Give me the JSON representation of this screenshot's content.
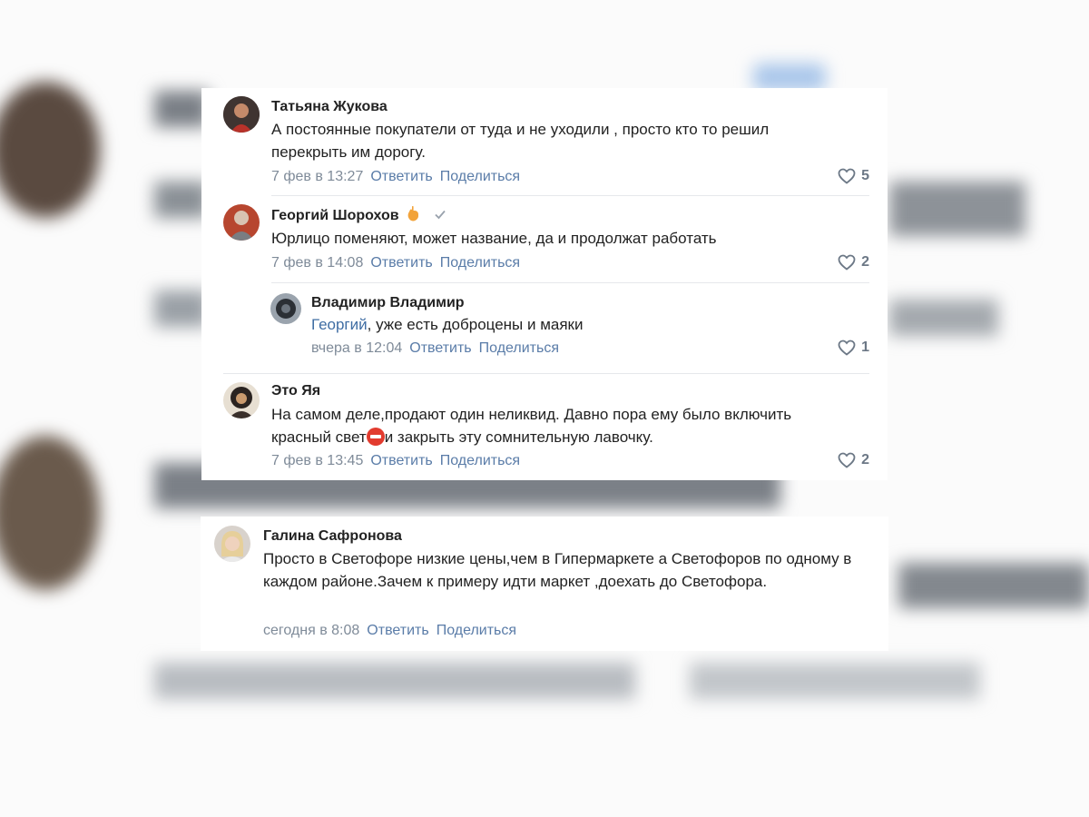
{
  "colors": {
    "author": "#222222",
    "text": "#222222",
    "meta": "#7f8b99",
    "action": "#5a7ca8",
    "mention": "#3f6da3",
    "like": "#6c7886",
    "separator": "#e6e8eb"
  },
  "actions": {
    "reply": "Ответить",
    "share": "Поделиться"
  },
  "comments": [
    {
      "author": "Татьяна Жукова",
      "text": "А постоянные покупатели от туда и не уходили , просто кто то решил перекрыть им дорогу.",
      "date": "7 фев в 13:27",
      "likes": "5"
    },
    {
      "author": "Георгий Шорохов",
      "badge_icon": "hand-emoji-icon",
      "verified_icon": "checkmark-icon",
      "text": "Юрлицо поменяют, может название, да и продолжат работать",
      "date": "7 фев в 14:08",
      "likes": "2"
    },
    {
      "author": "Владимир Владимир",
      "mention": "Георгий",
      "text": ", уже есть доброцены и маяки",
      "date": "вчера в 12:04",
      "likes": "1"
    },
    {
      "author": "Это Яя",
      "text_line1": "На самом деле,продают один неликвид. Давно пора ему было включить",
      "text_line2_before": "красный свет",
      "emoji_icon": "stop-sign-emoji-icon",
      "text_line2_after": "и закрыть эту сомнительную лавочку.",
      "date": "7 фев в 13:45",
      "likes": "2"
    },
    {
      "author": "Галина Сафронова",
      "text": "Просто в Светофоре низкие цены,чем в Гипермаркете а Светофоров по одному в каждом районе.Зачем к примеру идти маркет ,доехать до Светофора.",
      "date": "сегодня в 8:08"
    }
  ]
}
